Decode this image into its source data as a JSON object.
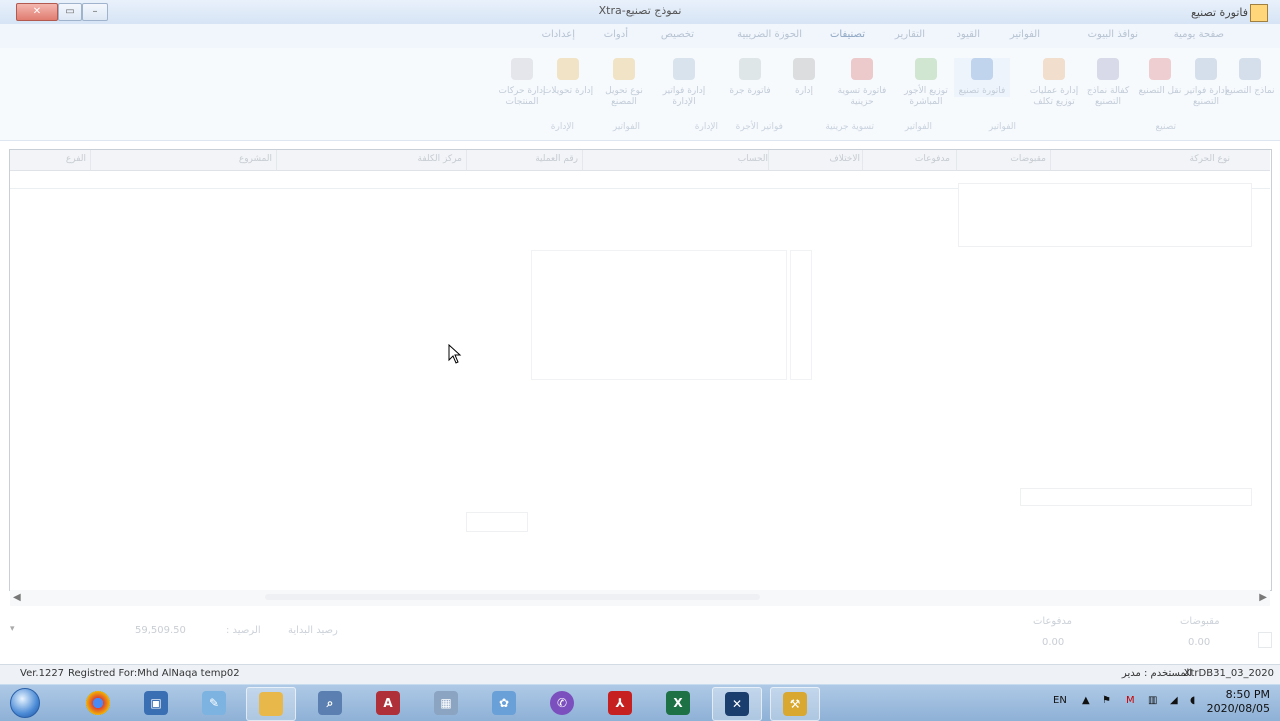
{
  "window": {
    "app_title": "Xtra-نموذج تصنيع",
    "doc_title": "فاتورة تصنيع"
  },
  "tabs": [
    "صفحة يومية",
    "نوافذ البيوت",
    "الفواتير",
    "القيود",
    "التقارير",
    "تصنيفات",
    "الحوزة الضريبية",
    "تخصيص",
    "أدوات",
    "إعدادات"
  ],
  "ribbon": {
    "buttons": [
      "نماذج التصنيع",
      "إدارة فواتير التصنيع",
      "نقل التصنيع",
      "كفالة نماذج التصنيع",
      "إدارة عمليات توزيع تكلف",
      "فاتورة تصنيع",
      "توزيع الأجور المباشرة",
      "فاتورة تسوية حزينية",
      "إدارة",
      "فاتورة جرة",
      "إدارة فواتير الإدارة",
      "نوع تحويل المصنع",
      "إدارة تحويلات",
      "إدارة حركات المنتجات"
    ],
    "groups": [
      "تصنيع",
      "الفواتير",
      "الفواتير",
      "تسوية جرينية",
      "فواتير الأجرة",
      "الإدارة",
      "الفواتير",
      "الإدارة"
    ]
  },
  "grid": {
    "columns": [
      "نوع الحركة",
      "مقبوضات",
      "مدفوعات",
      "الاختلاف",
      "الحساب",
      "رقم العملية",
      "مركز الكلفة",
      "المشروع",
      "الفرع"
    ]
  },
  "totals": {
    "opening_balance_label": "رصيد البداية",
    "balance_label": "الرصيد :",
    "balance_value": "59,509.50",
    "receipts_label": "مقبوضات",
    "receipts_value": "0.00",
    "payments_label": "مدفوعات",
    "payments_value": "0.00"
  },
  "status": {
    "version": "Ver.1227",
    "registered": "Registred For:Mhd AlNaqa temp02",
    "user": "المستخدم : مدير",
    "database": "XtrDB31_03_2020"
  },
  "taskbar": {
    "lang": "EN",
    "time": "8:50 PM",
    "date": "2020/08/05",
    "apps": [
      "chrome-icon",
      "computer-icon",
      "notepad-icon",
      "folder-icon",
      "search-icon",
      "access-icon",
      "calculator-icon",
      "paint-icon",
      "viber-icon",
      "acrobat-icon",
      "excel-icon",
      "xtra-icon",
      "tools-icon"
    ]
  },
  "colors": {
    "titlebar": "#d6e4f5",
    "taskbar": "#8eb1d6",
    "close_button": "#e07c70"
  }
}
